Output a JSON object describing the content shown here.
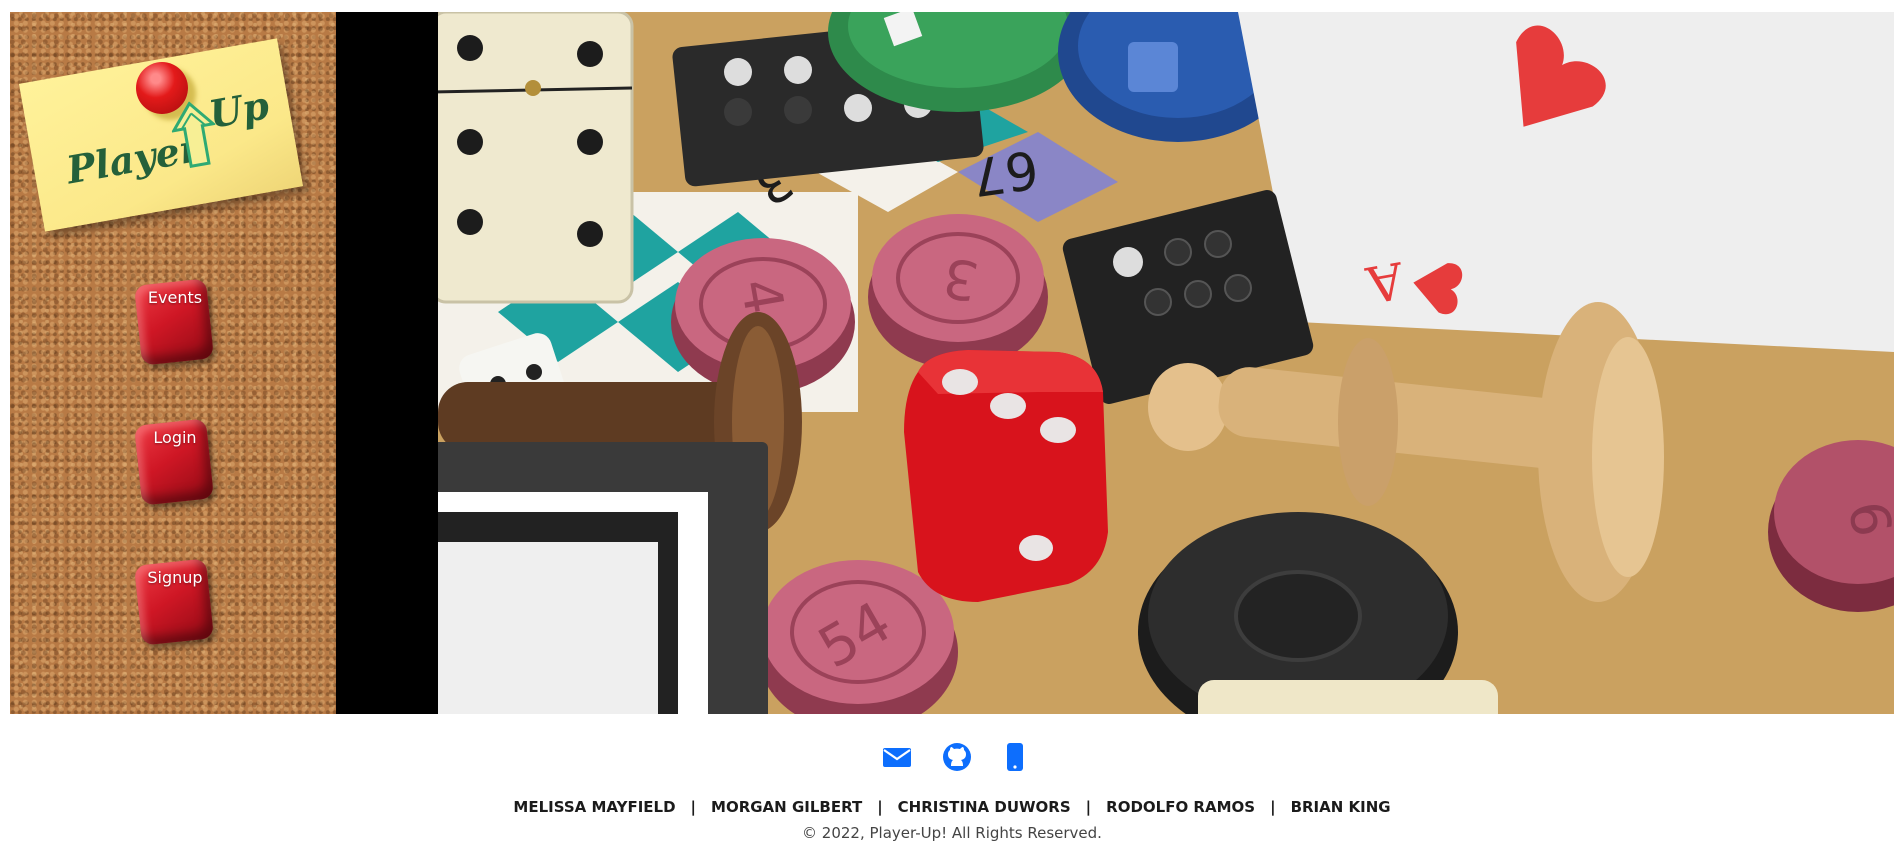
{
  "logo": {
    "word1": "Player",
    "word2": "Up",
    "arrow_icon": "up-arrow-icon"
  },
  "nav": {
    "items": [
      {
        "label": "Events"
      },
      {
        "label": "Login"
      },
      {
        "label": "Signup"
      }
    ]
  },
  "hero": {
    "icons": [
      "domino-icon",
      "poker-chip-icon",
      "ace-of-hearts-card-icon",
      "checker-icon",
      "red-die-icon",
      "chess-pawn-icon"
    ],
    "checker_numbers": [
      "4",
      "3",
      "54",
      "6"
    ],
    "board_numbers": [
      "3",
      "67"
    ],
    "card_rank": "A"
  },
  "footer": {
    "icons": [
      {
        "name": "email-icon",
        "color": "#0d6efd"
      },
      {
        "name": "github-icon",
        "color": "#0d6efd"
      },
      {
        "name": "phone-icon",
        "color": "#0d6efd"
      }
    ],
    "team": [
      "MELISSA MAYFIELD",
      "MORGAN GILBERT",
      "CHRISTINA DUWORS",
      "RODOLFO RAMOS",
      "BRIAN KING"
    ],
    "separator": "|",
    "copyright": "© 2022, Player-Up! All Rights Reserved."
  },
  "colors": {
    "accent": "#0d6efd",
    "cork": "#b87a45",
    "note": "#fbe889",
    "cube_red": "#cf1725",
    "logo_green": "#24603a"
  }
}
